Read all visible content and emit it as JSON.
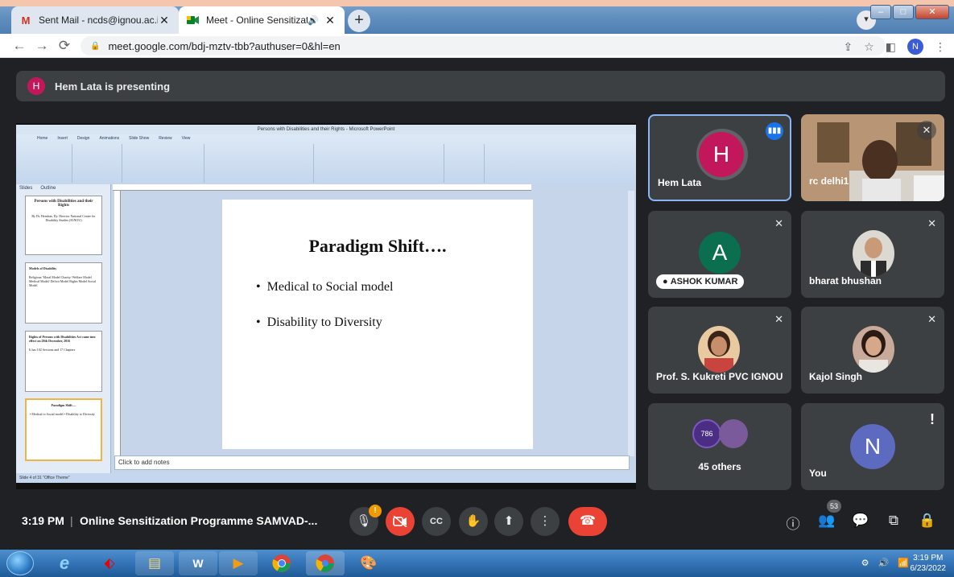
{
  "browser": {
    "tabs": [
      {
        "title": "Sent Mail - ncds@ignou.ac.in - I",
        "icon": "gmail-icon"
      },
      {
        "title": "Meet - Online Sensitization I",
        "icon": "meet-icon"
      }
    ],
    "url": "meet.google.com/bdj-mztv-tbb?authuser=0&hl=en",
    "profile_initial": "N"
  },
  "meet": {
    "presenting_initial": "H",
    "presenting_text": "Hem Lata is presenting",
    "time": "3:19 PM",
    "meeting_title": "Online Sensitization Programme SAMVAD-...",
    "people_count": "53",
    "participants": [
      {
        "name": "Hem Lata",
        "initial": "H",
        "color": "#c2185b"
      },
      {
        "name": "rc delhi1"
      },
      {
        "name": "ASHOK KUMAR",
        "initial": "A",
        "color": "#0b6e4f"
      },
      {
        "name": "bharat bhushan"
      },
      {
        "name": "Prof. S. Kukreti PVC IGNOU"
      },
      {
        "name": "Kajol Singh"
      },
      {
        "name": "45 others",
        "avatar_label": "786"
      },
      {
        "name": "You",
        "initial": "N",
        "color": "#5c6bc0"
      }
    ]
  },
  "ppt": {
    "window_title": "Persons with Disabilities and their Rights - Microsoft PowerPoint",
    "ribbon_tabs": [
      "Home",
      "Insert",
      "Design",
      "Animations",
      "Slide Show",
      "Review",
      "View"
    ],
    "pane_tabs": [
      "Slides",
      "Outline"
    ],
    "thumbs": [
      {
        "title": "Persons with Disabilities and their Rights",
        "body": "By Dr. Hemlata, Dy. Director National Centre for Disability Studies (IGNOU)"
      },
      {
        "title": "Models of Disability",
        "body": "Religious/ Moral Model Charity/ Welfare Model Medical Model/ Deficit Model Rights Model Social Model"
      },
      {
        "title": "Rights of Persons with Disabilities Act came into effect on 28th December, 2016",
        "body": "It has 102 Sections and 17 Chapters"
      },
      {
        "title": "Paradigm Shift….",
        "body": "• Medical to Social model  • Disability to Diversity"
      }
    ],
    "slide_title": "Paradigm Shift….",
    "bullet1": "Medical to Social model",
    "bullet2": "Disability to Diversity",
    "notes": "Click to add notes",
    "status": "Slide 4 of 31   \"Office Theme\""
  },
  "taskbar": {
    "time": "3:19 PM",
    "date": "6/23/2022"
  }
}
